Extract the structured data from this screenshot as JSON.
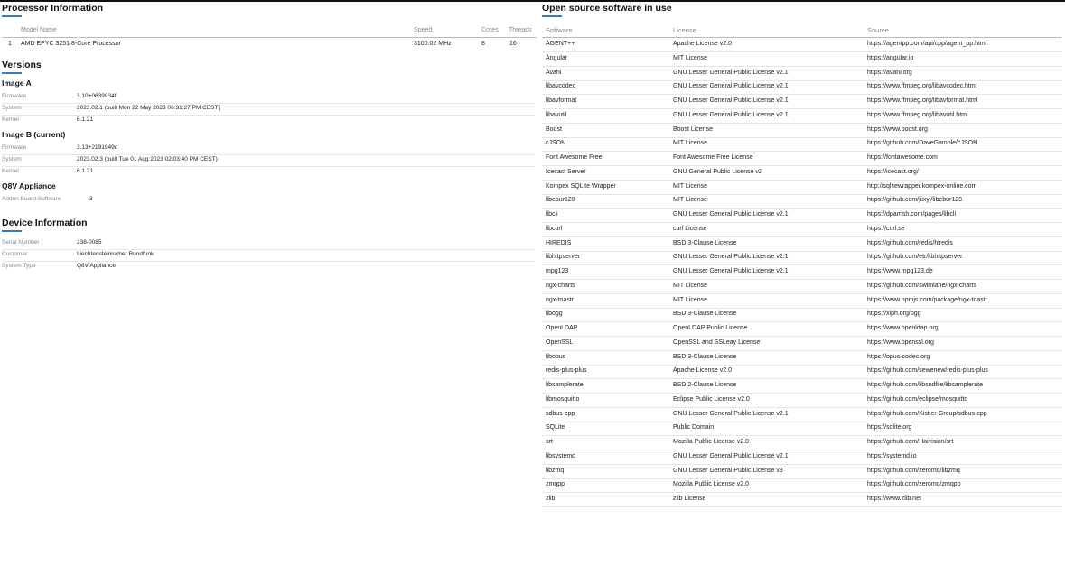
{
  "processor": {
    "title": "Processor Information",
    "columns": {
      "model": "Model Name",
      "speed": "Speed",
      "cores": "Cores",
      "threads": "Threads"
    },
    "rows": [
      {
        "index": "1",
        "model": "AMD EPYC 3251 8-Core Processor",
        "speed": "3100.02 MHz",
        "cores": "8",
        "threads": "16"
      }
    ]
  },
  "versions": {
    "title": "Versions",
    "image_a": {
      "title": "Image A",
      "firmware_label": "Firmware",
      "firmware": "3.10+0639934f",
      "system_label": "System",
      "system": "2023.02.1 (built Mon 22 May 2023 06:31:27 PM CEST)",
      "kernel_label": "Kernel",
      "kernel": "6.1.21"
    },
    "image_b": {
      "title": "Image B (current)",
      "firmware_label": "Firmware",
      "firmware": "3.13+2191949d",
      "system_label": "System",
      "system": "2023.02.3 (built Tue 01 Aug 2023 02:03:40 PM CEST)",
      "kernel_label": "Kernel",
      "kernel": "6.1.21"
    },
    "q8v": {
      "title": "Q8V Appliance",
      "addon_label": "Addon Board Software",
      "addon": "3"
    }
  },
  "device": {
    "title": "Device Information",
    "serial_label": "Serial Number",
    "serial": "238-0085",
    "customer_label": "Customer",
    "customer": "Liechtensteinischer Rundfunk",
    "type_label": "System Type",
    "type": "Q8V Appliance"
  },
  "opensource": {
    "title": "Open source software in use",
    "columns": {
      "software": "Software",
      "license": "License",
      "source": "Source"
    },
    "rows": [
      {
        "software": "AGENT++",
        "license": "Apache License v2.0",
        "source": "https://agentpp.com/api/cpp/agent_pp.html"
      },
      {
        "software": "Angular",
        "license": "MIT License",
        "source": "https://angular.io"
      },
      {
        "software": "Avahi",
        "license": "GNU Lesser General Public License v2.1",
        "source": "https://avahi.org"
      },
      {
        "software": "libavcodec",
        "license": "GNU Lesser General Public License v2.1",
        "source": "https://www.ffmpeg.org/libavcodec.html"
      },
      {
        "software": "libavformat",
        "license": "GNU Lesser General Public License v2.1",
        "source": "https://www.ffmpeg.org/libavformat.html"
      },
      {
        "software": "libavutil",
        "license": "GNU Lesser General Public License v2.1",
        "source": "https://www.ffmpeg.org/libavutil.html"
      },
      {
        "software": "Boost",
        "license": "Boost License",
        "source": "https://www.boost.org"
      },
      {
        "software": "cJSON",
        "license": "MIT License",
        "source": "https://github.com/DaveGamble/cJSON"
      },
      {
        "software": "Font Awesome Free",
        "license": "Font Awesome Free License",
        "source": "https://fontawesome.com"
      },
      {
        "software": "Icecast Server",
        "license": "GNU General Public License v2",
        "source": "https://icecast.org/"
      },
      {
        "software": "Kompex SQLite Wrapper",
        "license": "MIT License",
        "source": "http://sqlitewrapper.kompex-online.com"
      },
      {
        "software": "libebur128",
        "license": "MIT License",
        "source": "https://github.com/jiixyj/libebur128"
      },
      {
        "software": "libcli",
        "license": "GNU Lesser General Public License v2.1",
        "source": "https://dparrish.com/pages/libcli"
      },
      {
        "software": "libcurl",
        "license": "curl License",
        "source": "https://curl.se"
      },
      {
        "software": "HIREDIS",
        "license": "BSD 3-Clause License",
        "source": "https://github.com/redis/hiredis"
      },
      {
        "software": "libhttpserver",
        "license": "GNU Lesser General Public License v2.1",
        "source": "https://github.com/etr/libhttpserver"
      },
      {
        "software": "mpg123",
        "license": "GNU Lesser General Public License v2.1",
        "source": "https://www.mpg123.de"
      },
      {
        "software": "ngx-charts",
        "license": "MIT License",
        "source": "https://github.com/swimlane/ngx-charts"
      },
      {
        "software": "ngx-toastr",
        "license": "MIT License",
        "source": "https://www.npmjs.com/package/ngx-toastr"
      },
      {
        "software": "libogg",
        "license": "BSD 3-Clause License",
        "source": "https://xiph.org/ogg"
      },
      {
        "software": "OpenLDAP",
        "license": "OpenLDAP Public License",
        "source": "https://www.openldap.org"
      },
      {
        "software": "OpenSSL",
        "license": "OpenSSL and SSLeay License",
        "source": "https://www.openssl.org"
      },
      {
        "software": "libopus",
        "license": "BSD 3-Clause License",
        "source": "https://opus-codec.org"
      },
      {
        "software": "redis-plus-plus",
        "license": "Apache License v2.0",
        "source": "https://github.com/sewenew/redis-plus-plus"
      },
      {
        "software": "libsamplerate",
        "license": "BSD 2-Clause License",
        "source": "https://github.com/libsndfile/libsamplerate"
      },
      {
        "software": "libmosquitto",
        "license": "Eclipse Public License v2.0",
        "source": "https://github.com/eclipse/mosquitto"
      },
      {
        "software": "sdbus-cpp",
        "license": "GNU Lesser General Public License v2.1",
        "source": "https://github.com/Kistler-Group/sdbus-cpp"
      },
      {
        "software": "SQLite",
        "license": "Public Domain",
        "source": "https://sqlite.org"
      },
      {
        "software": "srt",
        "license": "Mozilla Public License v2.0",
        "source": "https://github.com/Haivision/srt"
      },
      {
        "software": "libsystemd",
        "license": "GNU Lesser General Public License v2.1",
        "source": "https://systemd.io"
      },
      {
        "software": "libzmq",
        "license": "GNU Lesser General Public License v3",
        "source": "https://github.com/zeromq/libzmq"
      },
      {
        "software": "zmqpp",
        "license": "Mozilla Public License v2.0",
        "source": "https://github.com/zeromq/zmqpp"
      },
      {
        "software": "zlib",
        "license": "zlib License",
        "source": "https://www.zlib.net"
      }
    ]
  }
}
